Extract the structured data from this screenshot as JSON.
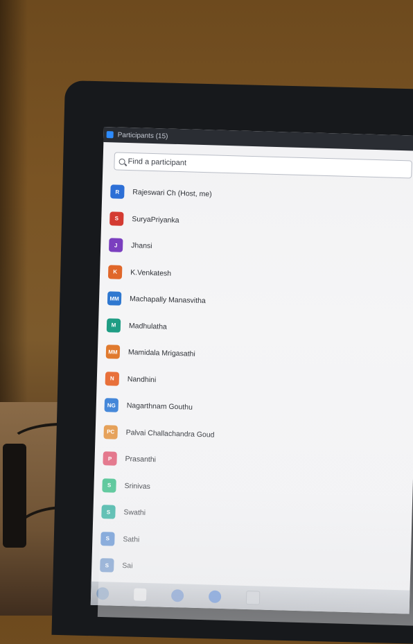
{
  "window": {
    "title": "Participants (15)"
  },
  "search": {
    "placeholder": "Find a participant"
  },
  "participants": [
    {
      "initials": "R",
      "name": "Rajeswari Ch (Host, me)",
      "color": "#2d6fd6"
    },
    {
      "initials": "S",
      "name": "SuryaPriyanka",
      "color": "#d43b32"
    },
    {
      "initials": "J",
      "name": "Jhansi",
      "color": "#7b3fbf"
    },
    {
      "initials": "K",
      "name": "K.Venkatesh",
      "color": "#e0672a"
    },
    {
      "initials": "MM",
      "name": "Machapally Manasvitha",
      "color": "#2f78d0"
    },
    {
      "initials": "M",
      "name": "Madhulatha",
      "color": "#1f9d84"
    },
    {
      "initials": "MM",
      "name": "Mamidala Mrigasathi",
      "color": "#e07a2e"
    },
    {
      "initials": "N",
      "name": "Nandhini",
      "color": "#e8703a"
    },
    {
      "initials": "NG",
      "name": "Nagarthnam Gouthu",
      "color": "#3f84d8"
    },
    {
      "initials": "PC",
      "name": "Palvai Challachandra Goud",
      "color": "#e49a4c"
    },
    {
      "initials": "P",
      "name": "Prasanthi",
      "color": "#e1657d"
    },
    {
      "initials": "S",
      "name": "Srinivas",
      "color": "#3fbf8a"
    },
    {
      "initials": "S",
      "name": "Swathi",
      "color": "#34b0a0"
    },
    {
      "initials": "S",
      "name": "Sathi",
      "color": "#5d8ed0"
    },
    {
      "initials": "S",
      "name": "Sai",
      "color": "#6f95c9"
    }
  ],
  "taskbar": {
    "icons": [
      "start-icon",
      "file-explorer-icon",
      "chrome-icon",
      "edge-icon",
      "zoom-icon"
    ]
  }
}
